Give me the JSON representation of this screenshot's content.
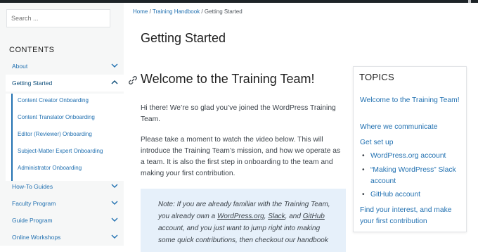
{
  "sidebar": {
    "search_placeholder": "Search ...",
    "contents_title": "CONTENTS",
    "items": [
      {
        "label": "About"
      },
      {
        "label": "Getting Started"
      },
      {
        "label": "How-To Guides"
      },
      {
        "label": "Faculty Program"
      },
      {
        "label": "Guide Program"
      },
      {
        "label": "Online Workshops"
      }
    ],
    "sub_items": [
      {
        "label": "Content Creator Onboarding"
      },
      {
        "label": "Content Translator Onboarding"
      },
      {
        "label": "Editor (Reviewer) Onboarding"
      },
      {
        "label": "Subject-Matter Expert Onboarding"
      },
      {
        "label": "Administrator Onboarding"
      }
    ]
  },
  "breadcrumb": {
    "home": "Home",
    "sep": " / ",
    "section": "Training Handbook",
    "current": "Getting Started"
  },
  "main": {
    "title": "Getting Started",
    "heading": "Welcome to the Training Team!",
    "para1": "Hi there! We’re so glad you’ve joined the WordPress Training Team.",
    "para2": "Please take a moment to watch the video below. This will introduce the Training Team’s mission, and how we operate as a team. It is also the first step in onboarding to the team and making your first contribution.",
    "note": {
      "t1": "Note: If you are already familiar with the Training Team, you already own a ",
      "l1": "WordPress.org",
      "t2": ", ",
      "l2": "Slack",
      "t3": ", and ",
      "l3": "GitHub",
      "t4": " account, and you just want to jump right into making some quick contributions, then checkout our handbook"
    }
  },
  "topics": {
    "title": "TOPICS",
    "items": [
      "Welcome to the Training Team!",
      "Where we communicate",
      "Get set up"
    ],
    "sub": [
      "WordPress.org account",
      "“Making WordPress” Slack account",
      "GitHub account"
    ],
    "last": "Find your interest, and make your first contribution"
  },
  "colors": {
    "link": "#2271b1",
    "sidebar_bg": "#f6f7f7",
    "note_bg": "#e6f0fa"
  }
}
